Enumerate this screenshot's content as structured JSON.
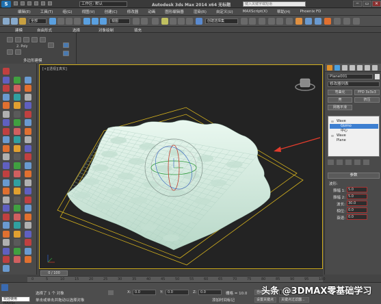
{
  "titlebar": {
    "logo_letter": "S",
    "workspace_label": "工作区: 默认",
    "app_title": "Autodesk 3ds Max  2014 x64   无标题",
    "search_placeholder": "键入关键字或短语",
    "minimize_icon": "minimize-icon",
    "restore_icon": "restore-icon",
    "close_icon": "close-icon",
    "minimize_glyph": "─",
    "restore_glyph": "▭",
    "close_glyph": "✕"
  },
  "menu": [
    "编辑(E)",
    "工具(T)",
    "组(G)",
    "视图(V)",
    "创建(C)",
    "修改器",
    "动画",
    "图形编辑器",
    "渲染(R)",
    "自定义(U)",
    "MAXScript(X)",
    "帮助(H)",
    "Phoenix FD"
  ],
  "toolbar": {
    "selection_filter": "全部",
    "coord_system": "视图",
    "named_selection": "创建选择集"
  },
  "ribbon": {
    "tabs": [
      "建模",
      "自由形式",
      "选择",
      "对象绘制",
      "填充"
    ],
    "polygon_label": "多边形建模",
    "poly_row": "2. Poly"
  },
  "viewport": {
    "label": "[+][透视][真实]",
    "frame_counter": "0 / 100"
  },
  "cmdpanel": {
    "object_name": "Plane001",
    "modifier_list": "修改器列表",
    "buttons": [
      "弯曲化",
      "FFD 3x3x3",
      "壳",
      "挤压",
      "网格平滑"
    ],
    "stack": [
      "Wave",
      "Gizmo",
      "中心",
      "Wave",
      "Plane"
    ],
    "params_title": "参数",
    "params_subtitle": "波形:",
    "params": [
      {
        "label": "振幅 1:",
        "value": "5.0"
      },
      {
        "label": "振幅 2:",
        "value": "5.0"
      },
      {
        "label": "波长:",
        "value": "30.0"
      },
      {
        "label": "相位:",
        "value": "0.0"
      },
      {
        "label": "衰退:",
        "value": "0.0"
      }
    ]
  },
  "timeline": {
    "ticks": [
      "0",
      "5",
      "10",
      "15",
      "20",
      "25",
      "30",
      "35",
      "40",
      "45",
      "50",
      "55",
      "60",
      "65",
      "70",
      "75",
      "80",
      "85",
      "90",
      "95",
      "100"
    ]
  },
  "status": {
    "maxscript_label": "欢迎使用 MAXSc",
    "line1": "选择了 1 个 对象",
    "line2": "单击或单击并拖动以选择对象",
    "x_label": "X:",
    "x_value": "0.0",
    "y_label": "Y:",
    "y_value": "0.0",
    "z_label": "Z:",
    "z_value": "0.0",
    "grid_label": "栅格 = 10.0",
    "autokey": "自动关键点",
    "set_key": "设置关键点",
    "selected_label": "选定对象",
    "key_filter": "关键点过滤器...",
    "add_time_tag": "添加时间标记"
  },
  "watermark": "头条 @3DMAX零基础学习",
  "colors": {
    "viewport_bg": "#232323",
    "selection_frame": "#d4b11e",
    "mesh": "#d8f0e4",
    "annotation_arrow": "#e23c2c",
    "stack_selected": "#3d7fd1"
  }
}
